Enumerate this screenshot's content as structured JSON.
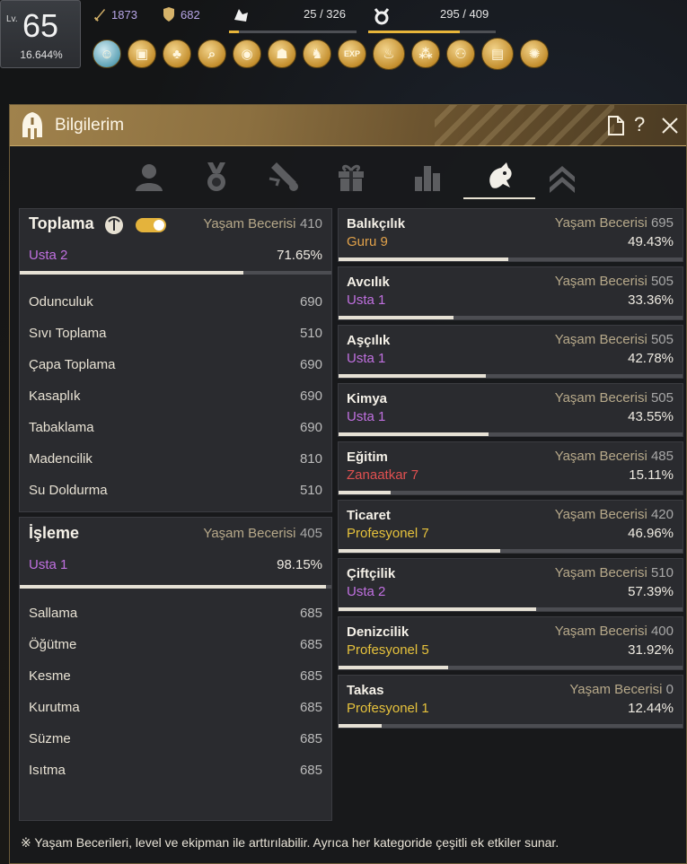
{
  "hud": {
    "level_prefix": "Lv.",
    "level": "65",
    "level_pct": "16.644%",
    "attack": "1873",
    "defense": "682",
    "weight": "25 / 326",
    "weight_fill": 0.077,
    "inventory": "295 / 409",
    "inventory_fill": 0.72,
    "quick_icons": [
      "pet-icon",
      "backpack-icon",
      "tree-icon",
      "search-icon",
      "palette-icon",
      "book-icon",
      "character-icon",
      "exp-icon",
      "campfire-icon",
      "molecule-icon",
      "team-icon",
      "map-icon",
      "gear-circle-icon"
    ],
    "exp_label": "EXP"
  },
  "panel": {
    "title": "Bilgilerim",
    "tabs": [
      "profile-tab",
      "medal-tab",
      "scroll-tab",
      "gift-tab",
      "stats-tab",
      "life-skill-tab",
      "rank-tab"
    ],
    "active_tab": "life-skill-tab"
  },
  "gathering": {
    "title": "Toplama",
    "skill_label": "Yaşam Becerisi",
    "skill_value": "410",
    "grade": "Usta 2",
    "grade_color": "#c070e0",
    "pct": "71.65%",
    "progress": 0.7165,
    "items": [
      {
        "name": "Odunculuk",
        "value": "690"
      },
      {
        "name": "Sıvı Toplama",
        "value": "510"
      },
      {
        "name": "Çapa Toplama",
        "value": "690"
      },
      {
        "name": "Kasaplık",
        "value": "690"
      },
      {
        "name": "Tabaklama",
        "value": "690"
      },
      {
        "name": "Madencilik",
        "value": "810"
      },
      {
        "name": "Su Doldurma",
        "value": "510"
      }
    ]
  },
  "processing": {
    "title": "İşleme",
    "skill_label": "Yaşam Becerisi",
    "skill_value": "405",
    "grade": "Usta 1",
    "grade_color": "#c070e0",
    "pct": "98.15%",
    "progress": 0.9815,
    "items": [
      {
        "name": "Sallama",
        "value": "685"
      },
      {
        "name": "Öğütme",
        "value": "685"
      },
      {
        "name": "Kesme",
        "value": "685"
      },
      {
        "name": "Kurutma",
        "value": "685"
      },
      {
        "name": "Süzme",
        "value": "685"
      },
      {
        "name": "Isıtma",
        "value": "685"
      }
    ]
  },
  "skills": [
    {
      "name": "Balıkçılık",
      "label": "Yaşam Becerisi",
      "value": "695",
      "grade": "Guru 9",
      "grade_color": "#e2a24a",
      "pct": "49.43%",
      "progress": 0.4943
    },
    {
      "name": "Avcılık",
      "label": "Yaşam Becerisi",
      "value": "505",
      "grade": "Usta 1",
      "grade_color": "#c070e0",
      "pct": "33.36%",
      "progress": 0.3336
    },
    {
      "name": "Aşçılık",
      "label": "Yaşam Becerisi",
      "value": "505",
      "grade": "Usta 1",
      "grade_color": "#c070e0",
      "pct": "42.78%",
      "progress": 0.4278
    },
    {
      "name": "Kimya",
      "label": "Yaşam Becerisi",
      "value": "505",
      "grade": "Usta 1",
      "grade_color": "#c070e0",
      "pct": "43.55%",
      "progress": 0.4355
    },
    {
      "name": "Eğitim",
      "label": "Yaşam Becerisi",
      "value": "485",
      "grade": "Zanaatkar 7",
      "grade_color": "#e05050",
      "pct": "15.11%",
      "progress": 0.1511
    },
    {
      "name": "Ticaret",
      "label": "Yaşam Becerisi",
      "value": "420",
      "grade": "Profesyonel 7",
      "grade_color": "#e6c23c",
      "pct": "46.96%",
      "progress": 0.4696
    },
    {
      "name": "Çiftçilik",
      "label": "Yaşam Becerisi",
      "value": "510",
      "grade": "Usta 2",
      "grade_color": "#c070e0",
      "pct": "57.39%",
      "progress": 0.5739
    },
    {
      "name": "Denizcilik",
      "label": "Yaşam Becerisi",
      "value": "400",
      "grade": "Profesyonel 5",
      "grade_color": "#e6c23c",
      "pct": "31.92%",
      "progress": 0.3192
    },
    {
      "name": "Takas",
      "label": "Yaşam Becerisi",
      "value": "0",
      "grade": "Profesyonel 1",
      "grade_color": "#e6c23c",
      "pct": "12.44%",
      "progress": 0.1244
    }
  ],
  "footer": "※ Yaşam Becerileri, level ve ekipman ile arttırılabilir. Ayrıca her kategoride çeşitli ek etkiler sunar."
}
